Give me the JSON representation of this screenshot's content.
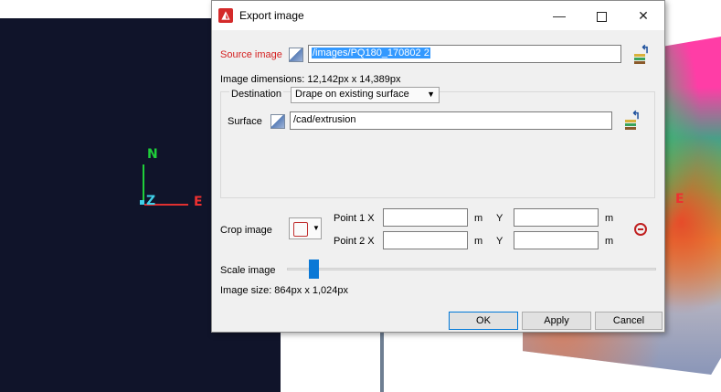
{
  "background": {
    "axis_n": "N",
    "axis_z": "Z",
    "axis_e": "E",
    "axis_e_right": "E"
  },
  "dialog": {
    "title": "Export image",
    "source_image_label": "Source image",
    "source_image_value": "/images/PQ180_170802 2",
    "image_dimensions": "Image dimensions: 12,142px x 14,389px",
    "destination_label": "Destination",
    "destination_value": "Drape on existing surface",
    "surface_label": "Surface",
    "surface_value": "/cad/extrusion",
    "crop_label": "Crop image",
    "point1_label": "Point 1 X",
    "point2_label": "Point 2 X",
    "unit_m": "m",
    "y_label": "Y",
    "scale_label": "Scale image",
    "scale_level": 0.06,
    "image_size": "Image size: 864px x 1,024px",
    "ok": "OK",
    "apply": "Apply",
    "cancel": "Cancel"
  },
  "colors": {
    "accent": "#0a78d6",
    "error_label": "#d42020",
    "selection": "#3399ff"
  },
  "icons": [
    "app-icon",
    "image-icon",
    "layers-icon",
    "crop-icon",
    "remove-icon",
    "close-icon",
    "minimize-icon",
    "maximize-icon"
  ]
}
